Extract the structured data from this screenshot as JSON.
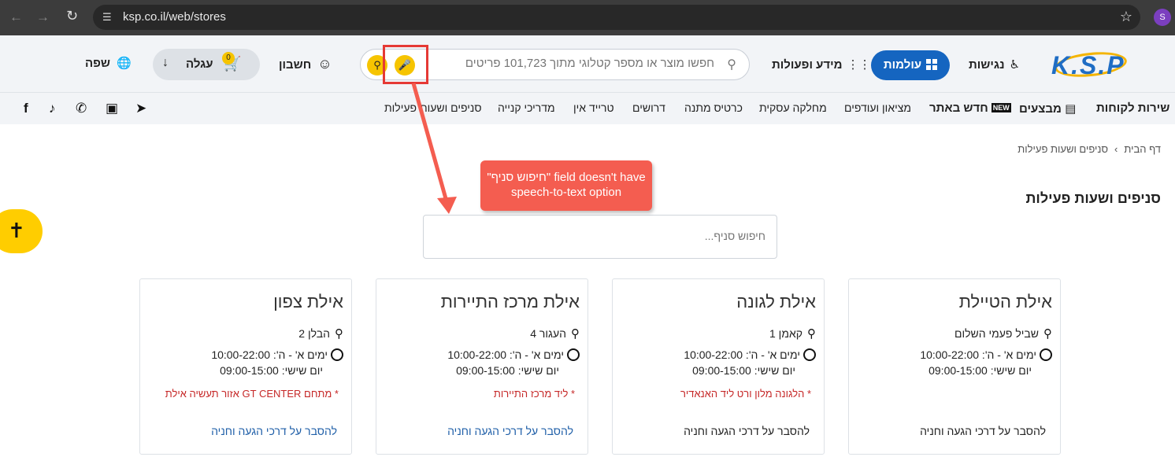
{
  "browser": {
    "url": "ksp.co.il/web/stores",
    "profile_initial": "S"
  },
  "header": {
    "logo": "K.S.P",
    "accessibility_label": "נגישות",
    "worlds_label": "עולמות",
    "info_label": "מידע ופעולות",
    "search_placeholder": "חפשו מוצר או מספר קטלוגי מתוך 101,723 פריטים",
    "account_label": "חשבון",
    "cart_label": "עגלה",
    "cart_count": "0",
    "language_label": "שפה"
  },
  "menu": {
    "customer_service": "שירות לקוחות",
    "deals": "מבצעים",
    "new_on_site": "חדש באתר",
    "new_badge": "NEW",
    "outlet": "מציאון ועודפים",
    "business": "מחלקה עסקית",
    "gift_card": "כרטיס מתנה",
    "jobs": "דרושים",
    "trade_in": "טרייד אין",
    "guides": "מדריכי קנייה",
    "stores": "סניפים ושעות פעילות"
  },
  "breadcrumb": {
    "home": "דף הבית",
    "current": "סניפים ושעות פעילות"
  },
  "page": {
    "title": "סניפים ושעות פעילות",
    "branch_search_placeholder": "חיפוש סניף..."
  },
  "annotation": {
    "callout_text": "\"חיפוש סניף\" field doesn't have speech-to-text option"
  },
  "stores": [
    {
      "name": "אילת הטיילת",
      "address": "שביל פעמי השלום",
      "hours": "ימים א' - ה': 10:00-22:00",
      "friday": "יום שישי: 09:00-15:00",
      "note": "",
      "link": "להסבר על דרכי הגעה וחניה"
    },
    {
      "name": "אילת לגונה",
      "address": "קאמן 1",
      "hours": "ימים א' - ה': 10:00-22:00",
      "friday": "יום שישי: 09:00-15:00",
      "note": "* הלגונה מלון ורט ליד האנאדיר",
      "link": "להסבר על דרכי הגעה וחניה"
    },
    {
      "name": "אילת מרכז התיירות",
      "address": "העגור 4",
      "hours": "ימים א' - ה': 10:00-22:00",
      "friday": "יום שישי: 09:00-15:00",
      "note": "* ליד מרכז התיירות",
      "link": "להסבר על דרכי הגעה וחניה"
    },
    {
      "name": "אילת צפון",
      "address": "הבלן 2",
      "hours": "ימים א' - ה': 10:00-22:00",
      "friday": "יום שישי: 09:00-15:00",
      "note": "* מתחם GT CENTER אזור תעשיה אילת",
      "link": "להסבר על דרכי הגעה וחניה"
    }
  ]
}
